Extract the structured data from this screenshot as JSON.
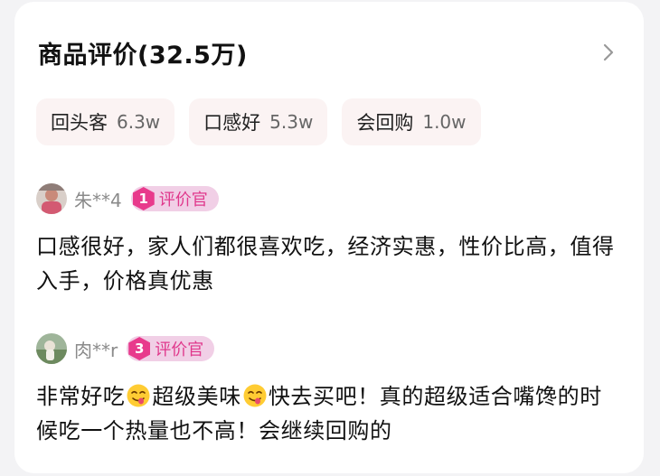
{
  "header": {
    "title": "商品评价(32.5万)"
  },
  "tags": [
    {
      "label": "回头客",
      "count": "6.3w"
    },
    {
      "label": "口感好",
      "count": "5.3w"
    },
    {
      "label": "会回购",
      "count": "1.0w"
    }
  ],
  "reviews": [
    {
      "username": "朱**4",
      "badge_level": "1",
      "badge_label": "评价官",
      "text": "口感很好，家人们都很喜欢吃，经济实惠，性价比高，值得入手，价格真优惠"
    },
    {
      "username": "肉**r",
      "badge_level": "3",
      "badge_label": "评价官",
      "text_part1": "非常好吃",
      "text_part2": "超级美味",
      "text_part3": "快去买吧！真的超级适合嘴馋的时候吃一个热量也不高！会继续回购的"
    }
  ],
  "icons": {
    "chevron": "chevron-right-icon",
    "emoji": "yum-face-emoji-icon"
  },
  "colors": {
    "badge_accent": "#e83a8c",
    "badge_bg": "#f1cfe6",
    "tag_bg": "#fbf3f3"
  }
}
